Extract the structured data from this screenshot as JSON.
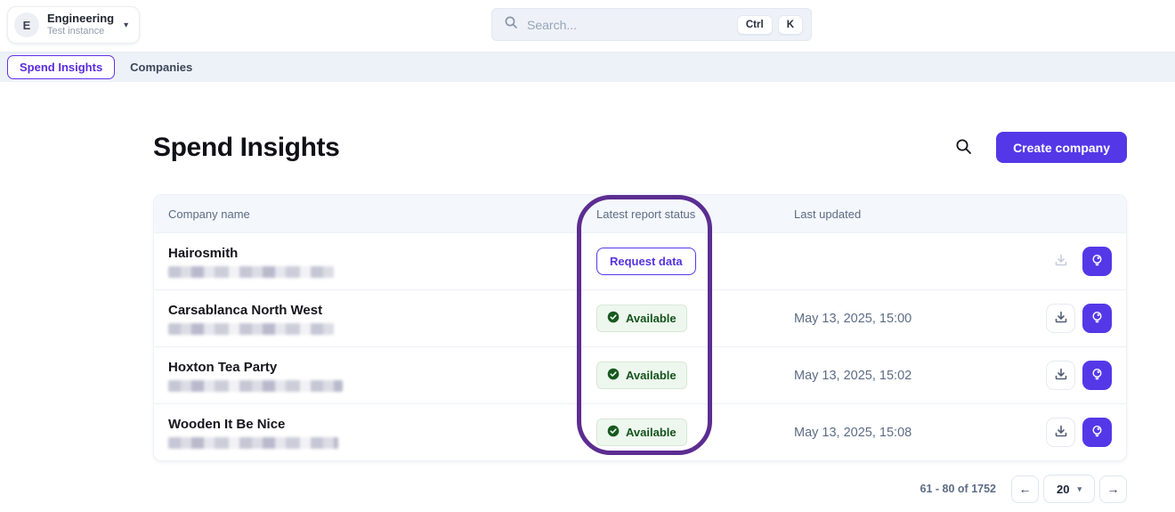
{
  "brand": {
    "avatar_initial": "E",
    "org_name": "Engineering",
    "instance_label": "Test instance"
  },
  "search": {
    "placeholder": "Search...",
    "shortcut_keys": [
      "Ctrl",
      "K"
    ]
  },
  "tabs": [
    {
      "label": "Spend Insights",
      "active": true
    },
    {
      "label": "Companies",
      "active": false
    }
  ],
  "page": {
    "title": "Spend Insights",
    "create_button_label": "Create company"
  },
  "table": {
    "columns": [
      "Company name",
      "Latest report status",
      "Last updated"
    ],
    "rows": [
      {
        "company": "Hairosmith",
        "status": "Request data",
        "status_type": "request",
        "last_updated": ""
      },
      {
        "company": "Carsablanca North West",
        "status": "Available",
        "status_type": "available",
        "last_updated": "May 13, 2025, 15:00"
      },
      {
        "company": "Hoxton Tea Party",
        "status": "Available",
        "status_type": "available",
        "last_updated": "May 13, 2025, 15:02"
      },
      {
        "company": "Wooden It Be Nice",
        "status": "Available",
        "status_type": "available",
        "last_updated": "May 13, 2025, 15:08"
      }
    ]
  },
  "pagination": {
    "range_text": "61 - 80 of 1752",
    "page_size": "20"
  },
  "icons": {
    "prev_arrow": "←",
    "next_arrow": "→",
    "caret_down": "▾"
  },
  "colors": {
    "accent_purple": "#5438e8",
    "annotation_purple": "#5c2d91",
    "available_green_text": "#14531c",
    "available_green_bg": "#eef7ee",
    "tabbar_bg": "#edf1f8",
    "table_header_bg": "#f4f7fb",
    "muted_text": "#5d6c86"
  }
}
